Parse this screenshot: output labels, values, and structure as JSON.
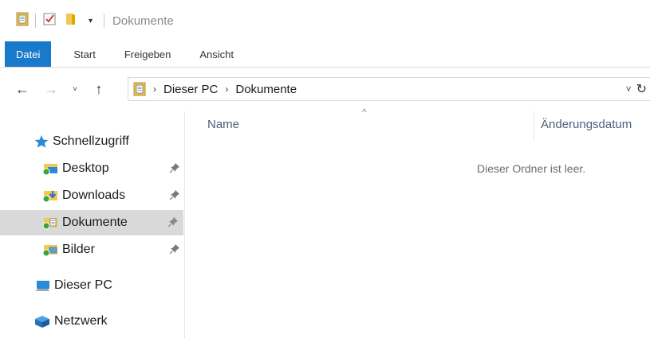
{
  "window": {
    "title": "Dokumente"
  },
  "quick_access_toolbar": {
    "icons": [
      "properties-icon",
      "checkmark-icon",
      "new-folder-icon"
    ],
    "dropdown_glyph": "▾"
  },
  "ribbon": {
    "tabs": [
      {
        "label": "Datei",
        "active_color": "#1979ca"
      },
      {
        "label": "Start"
      },
      {
        "label": "Freigeben"
      },
      {
        "label": "Ansicht"
      }
    ]
  },
  "navigation": {
    "back_glyph": "←",
    "forward_glyph": "→",
    "recent_glyph": "˅",
    "up_glyph": "↑"
  },
  "address_bar": {
    "crumbs": [
      "Dieser PC",
      "Dokumente"
    ],
    "separator": "›",
    "dropdown_glyph": "˅",
    "refresh_glyph": "↻"
  },
  "sidebar": {
    "quick_access_label": "Schnellzugriff",
    "items": [
      {
        "label": "Desktop",
        "pinned": true
      },
      {
        "label": "Downloads",
        "pinned": true
      },
      {
        "label": "Dokumente",
        "pinned": true,
        "selected": true
      },
      {
        "label": "Bilder",
        "pinned": true
      }
    ],
    "this_pc_label": "Dieser PC",
    "network_label": "Netzwerk"
  },
  "content": {
    "columns": [
      "Name",
      "Änderungsdatum"
    ],
    "sort_glyph": "^",
    "empty_message": "Dieser Ordner ist leer."
  }
}
